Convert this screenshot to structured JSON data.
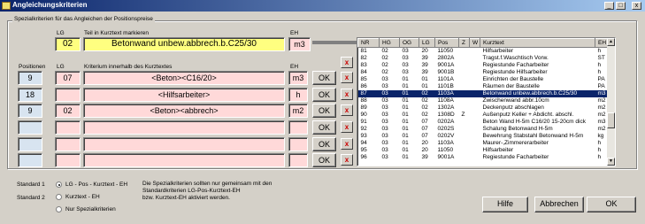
{
  "window": {
    "title": "Angleichungskriterien",
    "controls": [
      "_",
      "□",
      "x"
    ]
  },
  "group": {
    "title": "Spezialkriterien für das Angleichen der Positionspreise"
  },
  "header": {
    "lg_label": "LG",
    "teil_label": "Teil in Kurztext markieren",
    "eh_label": "EH",
    "lg_value": "02",
    "teil_value": "Betonwand unbew.abbrech.b.C25/30",
    "eh_value": "m3"
  },
  "criteria": {
    "positionen_label": "Positionen",
    "lg_label": "LG",
    "kriterium_label": "Kriterium innerhalb des Kurztextes",
    "eh_label": "EH",
    "ok_label": "OK",
    "x_label": "x",
    "rows": [
      {
        "positionen": "9",
        "lg": "07",
        "kriterium": "<Beton><C16/20>",
        "eh": "m3"
      },
      {
        "positionen": "18",
        "lg": "",
        "kriterium": "<Hilfsarbeiter>",
        "eh": "h"
      },
      {
        "positionen": "9",
        "lg": "02",
        "kriterium": "<Beton><abbrech>",
        "eh": "m2"
      },
      {
        "positionen": "",
        "lg": "",
        "kriterium": "",
        "eh": ""
      },
      {
        "positionen": "",
        "lg": "",
        "kriterium": "",
        "eh": ""
      },
      {
        "positionen": "",
        "lg": "",
        "kriterium": "",
        "eh": ""
      }
    ]
  },
  "list": {
    "columns": [
      "NR",
      "HG",
      "OG",
      "LG",
      "Pos",
      "Z",
      "W",
      "Kurztext",
      "EH"
    ],
    "rows": [
      [
        "81",
        "02",
        "03",
        "20",
        "11050",
        "",
        "",
        "Hilfsarbeiter",
        "h"
      ],
      [
        "82",
        "02",
        "03",
        "39",
        "2802A",
        "",
        "",
        "Tragst.f.Waschtisch Vorw.",
        "ST"
      ],
      [
        "83",
        "02",
        "03",
        "39",
        "9001A",
        "",
        "",
        "Regiestunde Facharbeiter",
        "h"
      ],
      [
        "84",
        "02",
        "03",
        "39",
        "9001B",
        "",
        "",
        "Regiestunde Hilfsarbeiter",
        "h"
      ],
      [
        "85",
        "03",
        "01",
        "01",
        "1101A",
        "",
        "",
        "Einrichten der Baustelle",
        "PA"
      ],
      [
        "86",
        "03",
        "01",
        "01",
        "1101B",
        "",
        "",
        "Räumen der Baustelle",
        "PA"
      ],
      [
        "87",
        "03",
        "01",
        "02",
        "1103A",
        "",
        "",
        "Betonwand unbew.abbrech.b.C25/30",
        "m3"
      ],
      [
        "88",
        "03",
        "01",
        "02",
        "1108A",
        "",
        "",
        "Zwischenwand abbr.10cm",
        "m2"
      ],
      [
        "89",
        "03",
        "01",
        "02",
        "1302A",
        "",
        "",
        "Deckenputz abschlagen",
        "m2"
      ],
      [
        "90",
        "03",
        "01",
        "02",
        "1308D",
        "Z",
        "",
        "Außenputz Keller + Abdicht. abschl.",
        "m2"
      ],
      [
        "91",
        "03",
        "01",
        "07",
        "0202A",
        "",
        "",
        "Beton Wand H-5m C16/20 15-20cm dick",
        "m3"
      ],
      [
        "92",
        "03",
        "01",
        "07",
        "0202S",
        "",
        "",
        "Schalung Betonwand H-5m",
        "m2"
      ],
      [
        "93",
        "03",
        "01",
        "07",
        "0202V",
        "",
        "",
        "Bewehrung Stabstahl Betonwand H-5m",
        "kg"
      ],
      [
        "94",
        "03",
        "01",
        "20",
        "1103A",
        "",
        "",
        "Maurer-,Zimmererarbeiter",
        "h"
      ],
      [
        "95",
        "03",
        "01",
        "20",
        "11050",
        "",
        "",
        "Hilfsarbeiter",
        "h"
      ],
      [
        "96",
        "03",
        "01",
        "39",
        "9001A",
        "",
        "",
        "Regiestunde Facharbeiter",
        "h"
      ]
    ],
    "selected_index": 6
  },
  "standards": {
    "standard1_label": "Standard 1",
    "standard2_label": "Standard 2",
    "options": [
      {
        "label": "LG - Pos - Kurztext - EH",
        "checked": true
      },
      {
        "label": "Kurztext - EH",
        "checked": false
      },
      {
        "label": "Nur Spezialkriterien",
        "checked": false
      }
    ],
    "note_lines": [
      "Die Spezialkriterien sollten nur gemeinsam mit den",
      "Standardkriterien LG-Pos-Kurztext-EH",
      "bzw. Kurztext-EH aktiviert werden."
    ]
  },
  "buttons": {
    "hilfe": "Hilfe",
    "abbrechen": "Abbrechen",
    "ok": "OK"
  }
}
